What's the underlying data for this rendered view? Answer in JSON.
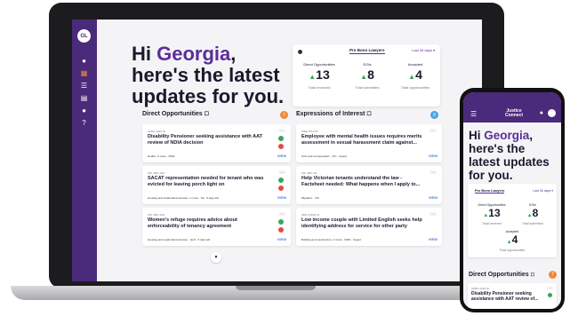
{
  "laptop": {
    "sidebar": {
      "avatar": "GL"
    },
    "greeting": {
      "prefix": "Hi ",
      "name": "Georgia",
      "suffix": ", here's the latest updates for you."
    },
    "stats": {
      "tab": "Pro Bono Lawyers",
      "period": "Last 30 days",
      "items": [
        {
          "label": "Direct Opportunities",
          "value": "13",
          "sub": "Total received"
        },
        {
          "label": "EOIs",
          "value": "8",
          "sub": "Total submitted"
        },
        {
          "label": "Accepted",
          "value": "4",
          "sub": "Total opportunities"
        }
      ]
    },
    "direct": {
      "title": "Direct Opportunities",
      "count": "7",
      "cards": [
        {
          "meta": "APRIL 2024 ID",
          "title": "Disability Pensioner seeking assistance with AAT review of NDIA decision",
          "tags": "Health • 3 more · NSW",
          "view": "VIEW"
        },
        {
          "meta": "FRI, 3RD JAN",
          "title": "SACAT representation needed for tenant who was evicted for leaving porch light on",
          "tags": "Housing and residential tenancies • 1 more · SA · 5 days left",
          "view": "VIEW"
        },
        {
          "meta": "FRI, 3RD JAN",
          "title": "Women's refuge requires advice about enforceability of tenancy agreement",
          "tags": "Housing and residential tenancies · QLD · 5 days left",
          "view": "VIEW"
        }
      ]
    },
    "eoi": {
      "title": "Expressions of Interest",
      "count": "8",
      "cards": [
        {
          "meta": "WED 5TH NC",
          "title": "Employee with mental health issues requires merits assessment in sexual harassment claim against...",
          "tags": "Torts and compensation · VIC · Urgent",
          "view": "VIEW"
        },
        {
          "meta": "FRI, 3RD JR",
          "title": "Help Victorian tenants understand the law - Factsheet needed: What happens when I apply to...",
          "tags": "Migration · VIC",
          "view": "VIEW"
        },
        {
          "meta": "3RD 5 MAR 24",
          "title": "Low income couple with Limited English seeks help identifying address for service for other party",
          "tags": "Building and construction • 2 more · NSW · Urgent",
          "view": "VIEW"
        }
      ]
    }
  },
  "phone": {
    "brand": "Justice Connect",
    "greeting": {
      "prefix": "Hi ",
      "name": "Georgia",
      "suffix": ", here's the latest updates for you."
    },
    "stats": {
      "tab": "Pro Bono Lawyers",
      "period": "Last 30 days",
      "items": [
        {
          "label": "Direct Opportunities",
          "value": "13",
          "sub": "Total received"
        },
        {
          "label": "EOIs",
          "value": "8",
          "sub": "Total submitted"
        },
        {
          "label": "Accepted",
          "value": "4",
          "sub": "Total opportunities"
        }
      ]
    },
    "direct": {
      "title": "Direct Opportunities",
      "count": "7",
      "card": {
        "meta": "APRIL 2024 ID",
        "title": "Disability Pensioner seeking assistance with AAT review of..."
      }
    }
  }
}
